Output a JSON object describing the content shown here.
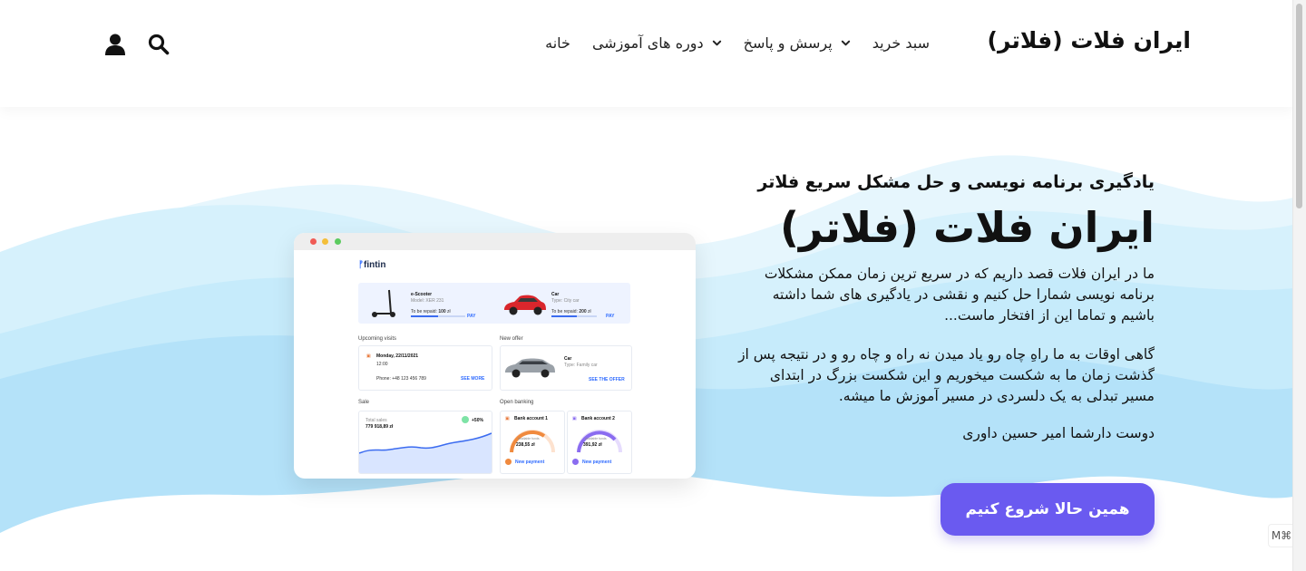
{
  "header": {
    "brand": "ایران فلات (فلاتر)",
    "nav": [
      {
        "label": "خانه",
        "dropdown": false
      },
      {
        "label": "دوره های آموزشی",
        "dropdown": true
      },
      {
        "label": "پرسش و پاسخ",
        "dropdown": true
      },
      {
        "label": "سبد خرید",
        "dropdown": false
      }
    ],
    "icons": [
      "search-icon",
      "user-icon"
    ]
  },
  "hero": {
    "tagline": "یادگیری برنامه نویسی و حل مشکل سریع فلاتر",
    "title": "ایران فلات (فلاتر)",
    "paragraph1": "ما در ایران فلات قصد داریم که در سریع ترین زمان ممکن مشکلات برنامه نویسی شمارا حل کنیم و نقشی در یادگیری های شما داشته باشیم و تماما این از افتخار ماست...",
    "paragraph2": "گاهی اوقات به ما راهِ چاه رو یاد میدن نه راه و چاه رو و در نتیجه پس از گذشت زمان ما به شکست میخوریم و این شکست بزرگ در ابتدای مسیر تبدلی به یک دلسردی در مسیر آموزش ما میشه.",
    "signature": "دوست دارشما امیر حسین داوری",
    "cta": "همین حالا شروع کنیم"
  },
  "mockup": {
    "logo": "fintin",
    "vehicles": [
      {
        "title": "e-Scooter",
        "sub": "Model: XER 231",
        "repaid_label": "To be repaid:",
        "repaid_value": "100",
        "currency": "zł",
        "action": "PAY"
      },
      {
        "title": "Car",
        "sub": "Type: City car",
        "repaid_label": "To be repaid:",
        "repaid_value": "200",
        "currency": "zł",
        "action": "PAY"
      }
    ],
    "upcoming": {
      "section": "Upcoming visits",
      "date": "Monday, 22/11/2021",
      "time": "12:00",
      "phone": "Phone: +48 123 456 789",
      "action": "SEE MORE"
    },
    "offer": {
      "section": "New offer",
      "title": "Car",
      "sub": "Type: Family car",
      "action": "SEE THE OFFER"
    },
    "sale": {
      "section": "Sale",
      "label": "Total sales",
      "value": "779 918,89",
      "currency": "zł",
      "change": "+50%"
    },
    "banking": {
      "section": "Open banking",
      "accounts": [
        {
          "name": "Bank account 1",
          "label": "Available funds",
          "value": "238,55",
          "currency": "zł",
          "action": "New payment"
        },
        {
          "name": "Bank account 2",
          "label": "Available funds",
          "value": "391,92",
          "currency": "zł",
          "action": "New payment"
        }
      ]
    }
  },
  "widget": {
    "badge": "M⌘"
  },
  "colors": {
    "accent": "#6a5af0",
    "wave_light": "#e2f5fd",
    "wave_mid": "#cdeefc",
    "wave_dark": "#b6e4fa",
    "text": "#111111"
  }
}
